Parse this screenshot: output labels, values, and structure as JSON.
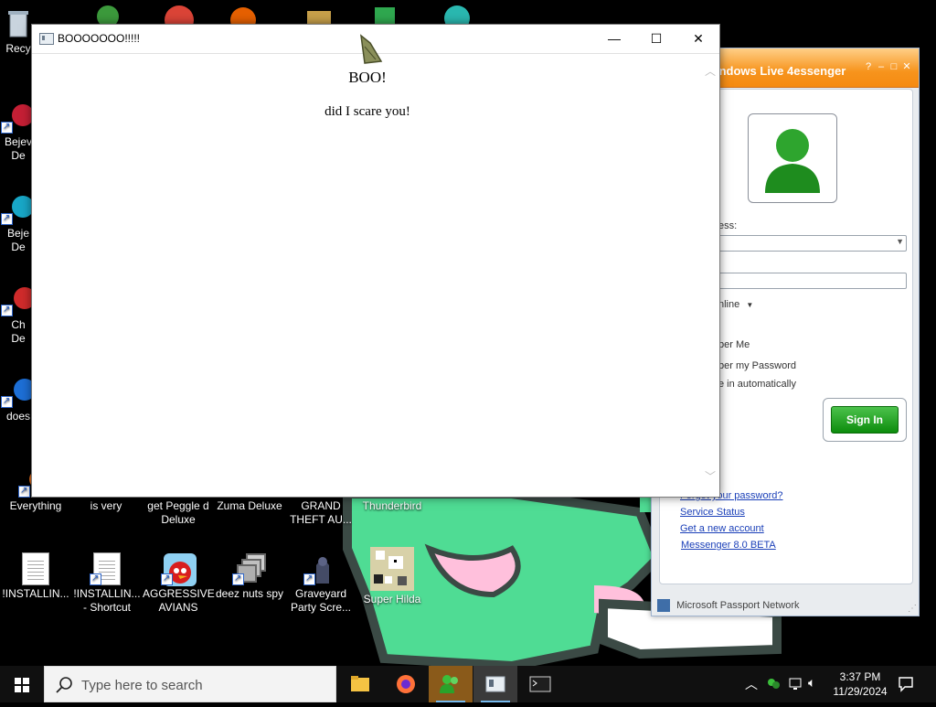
{
  "desktop": {
    "icons": [
      {
        "label": "Recy",
        "icon": "recycle-bin-icon"
      },
      {
        "label": "Bejev\nDe",
        "icon": "bejeweled-icon"
      },
      {
        "label": "Beje\nDe",
        "icon": "bejeweled-icon"
      },
      {
        "label": "Ch\nDe",
        "icon": "chuzzle-icon"
      },
      {
        "label": "does",
        "icon": "globe-icon"
      },
      {
        "label": "Everything",
        "icon": "search-app-icon"
      },
      {
        "label": "is very",
        "icon": "app-icon"
      },
      {
        "label": "get Peggle d\nDeluxe",
        "icon": "peggle-icon"
      },
      {
        "label": "Zuma Deluxe",
        "icon": "zuma-icon"
      },
      {
        "label": "GRAND\nTHEFT AU...",
        "icon": "gta-icon"
      },
      {
        "label": "Thunderbird",
        "icon": "thunderbird-icon"
      },
      {
        "label": "!INSTALLIN...",
        "icon": "text-document-icon"
      },
      {
        "label": "!INSTALLIN...\n- Shortcut",
        "icon": "text-document-icon"
      },
      {
        "label": "AGGRESSIVE\nAVIANS",
        "icon": "angry-bird-icon"
      },
      {
        "label": "deez nuts spy",
        "icon": "windows-stack-icon"
      },
      {
        "label": "Graveyard\nParty Scre...",
        "icon": "graveyard-icon"
      },
      {
        "label": "Super Hilda",
        "icon": "pixel-art-icon"
      }
    ]
  },
  "boo_window": {
    "title": "BOOOOOOO!!!!!",
    "heading": "BOO!",
    "text": "did I scare you!"
  },
  "messenger": {
    "title": "indows Live 4essenger",
    "email_label": "ess:",
    "status_value": "nline",
    "remember_me": "ber Me",
    "remember_password": "ber my Password",
    "sign_in_auto": "e in automatically",
    "sign_in_button": "Sign In",
    "links": [
      "Forgot your password?",
      "Service Status",
      "Get a new account",
      "Messenger 8.0 BETA"
    ],
    "footer": "Microsoft Passport Network"
  },
  "taskbar": {
    "search_placeholder": "Type here to search",
    "time": "3:37 PM",
    "date": "11/29/2024"
  },
  "colors": {
    "blob_green": "#4fdc94",
    "blob_pink": "#ffc0dc",
    "msn_orange": "#f7941d",
    "signin_green": "#1aa31a"
  }
}
